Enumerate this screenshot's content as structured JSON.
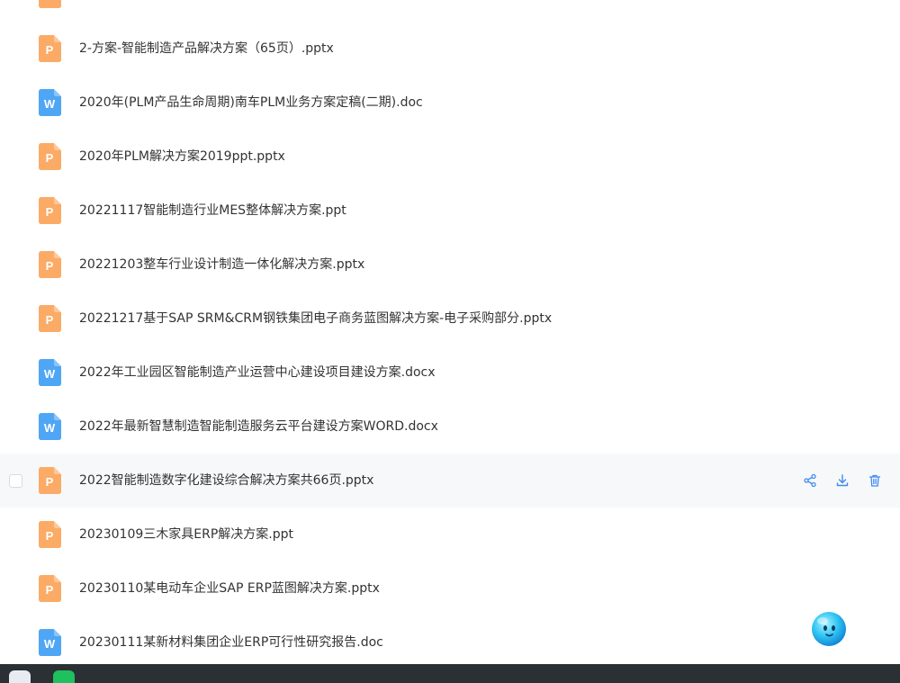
{
  "files": [
    {
      "name": "",
      "type": "pptx"
    },
    {
      "name": "2-方案-智能制造产品解决方案（65页）.pptx",
      "type": "pptx"
    },
    {
      "name": "2020年(PLM产品生命周期)南车PLM业务方案定稿(二期).doc",
      "type": "doc"
    },
    {
      "name": "2020年PLM解决方案2019ppt.pptx",
      "type": "pptx"
    },
    {
      "name": "20221117智能制造行业MES整体解决方案.ppt",
      "type": "pptx"
    },
    {
      "name": "20221203整车行业设计制造一体化解决方案.pptx",
      "type": "pptx"
    },
    {
      "name": "20221217基于SAP SRM&CRM钢铁集团电子商务蓝图解决方案-电子采购部分.pptx",
      "type": "pptx"
    },
    {
      "name": "2022年工业园区智能制造产业运营中心建设项目建设方案.docx",
      "type": "doc"
    },
    {
      "name": "2022年最新智慧制造智能制造服务云平台建设方案WORD.docx",
      "type": "doc"
    },
    {
      "name": "2022智能制造数字化建设综合解决方案共66页.pptx",
      "type": "pptx",
      "hovered": true
    },
    {
      "name": "20230109三木家具ERP解决方案.ppt",
      "type": "pptx"
    },
    {
      "name": "20230110某电动车企业SAP ERP蓝图解决方案.pptx",
      "type": "pptx"
    },
    {
      "name": "20230111某新材料集团企业ERP可行性研究报告.doc",
      "type": "doc"
    }
  ],
  "icons": {
    "ppt_letter": "P",
    "doc_letter": "W",
    "ppt_color": "#fbab66",
    "doc_color": "#4ea6f5",
    "action_color": "#3e8bf0",
    "hover_background": "#f7f8fa",
    "actions": [
      "share-icon",
      "download-icon",
      "delete-icon"
    ]
  }
}
